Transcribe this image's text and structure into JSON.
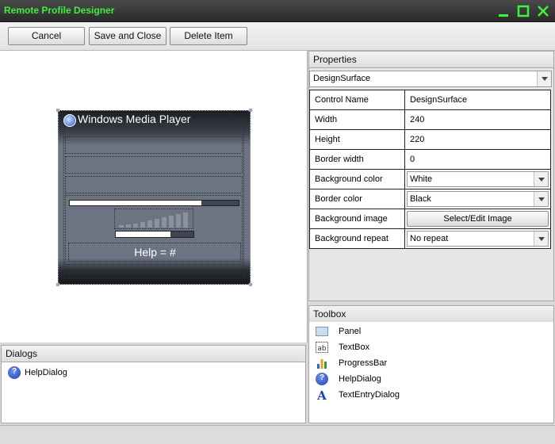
{
  "window": {
    "title": "Remote Profile Designer",
    "accent": "#3ef23e"
  },
  "toolbar": {
    "cancel": "Cancel",
    "save_close": "Save and Close",
    "delete_item": "Delete Item"
  },
  "skin": {
    "title": "Windows Media Player",
    "help_text": "Help = #",
    "progress_fill": 0.78,
    "volume_fill": 0.7
  },
  "properties": {
    "header": "Properties",
    "selected": "DesignSurface",
    "rows": [
      {
        "key": "Control Name",
        "value": "DesignSurface"
      },
      {
        "key": "Width",
        "value": "240"
      },
      {
        "key": "Height",
        "value": "220"
      },
      {
        "key": "Border width",
        "value": "0"
      },
      {
        "key": "Background color",
        "value": "White"
      },
      {
        "key": "Border color",
        "value": "Black"
      },
      {
        "key": "Background image",
        "value": "Select/Edit Image"
      },
      {
        "key": "Background repeat",
        "value": "No repeat"
      }
    ]
  },
  "toolbox": {
    "header": "Toolbox",
    "items": [
      {
        "label": "Panel",
        "icon": "panel-icon"
      },
      {
        "label": "TextBox",
        "icon": "textbox-icon"
      },
      {
        "label": "ProgressBar",
        "icon": "progressbar-icon"
      },
      {
        "label": "HelpDialog",
        "icon": "help-icon"
      },
      {
        "label": "TextEntryDialog",
        "icon": "text-entry-icon"
      }
    ]
  },
  "dialogs": {
    "header": "Dialogs",
    "items": [
      {
        "label": "HelpDialog",
        "icon": "help-icon"
      }
    ]
  }
}
